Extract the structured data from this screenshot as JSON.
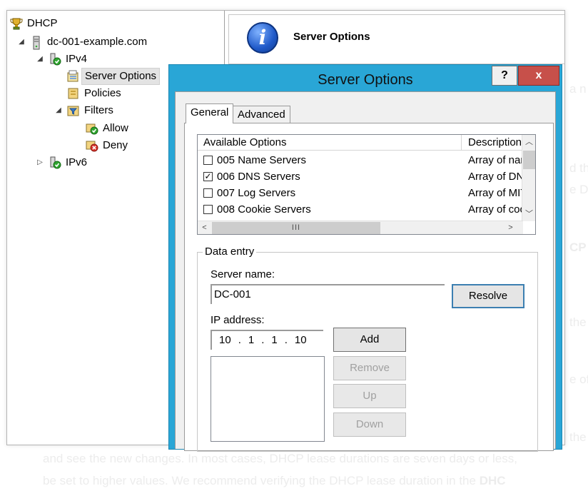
{
  "background_text": {
    "right_fragments": [
      "a n",
      "d th",
      "e DN",
      "CP",
      "the",
      "e of",
      "the"
    ],
    "line1": "and see the new changes. In most cases, DHCP lease durations are seven days or less,",
    "line2_prefix": "be set to higher values. We recommend verifying the DHCP lease duration in the ",
    "line2_bold": "DHC"
  },
  "tree": {
    "root": "DHCP",
    "server": "dc-001-example.com",
    "ipv4": "IPv4",
    "server_options": "Server Options",
    "policies": "Policies",
    "filters": "Filters",
    "allow": "Allow",
    "deny": "Deny",
    "ipv6": "IPv6"
  },
  "header": {
    "title": "Server Options"
  },
  "dialog": {
    "title": "Server Options",
    "help_label": "?",
    "close_label": "x",
    "tabs": [
      "General",
      "Advanced"
    ],
    "list": {
      "col_options": "Available Options",
      "col_description": "Description",
      "rows": [
        {
          "checked": false,
          "option": "005 Name Servers",
          "description": "Array of nam"
        },
        {
          "checked": true,
          "option": "006 DNS Servers",
          "description": "Array of DN"
        },
        {
          "checked": false,
          "option": "007 Log Servers",
          "description": "Array of MIT"
        },
        {
          "checked": false,
          "option": "008 Cookie Servers",
          "description": "Array of coo"
        }
      ],
      "hscroll_grip": "III"
    },
    "data_entry": {
      "legend": "Data entry",
      "server_name_label": "Server name:",
      "server_name_value": "DC-001",
      "resolve_label": "Resolve",
      "ip_label": "IP address:",
      "ip_octets": [
        "10",
        "1",
        "1",
        "10"
      ],
      "add_label": "Add",
      "remove_label": "Remove",
      "up_label": "Up",
      "down_label": "Down"
    }
  }
}
